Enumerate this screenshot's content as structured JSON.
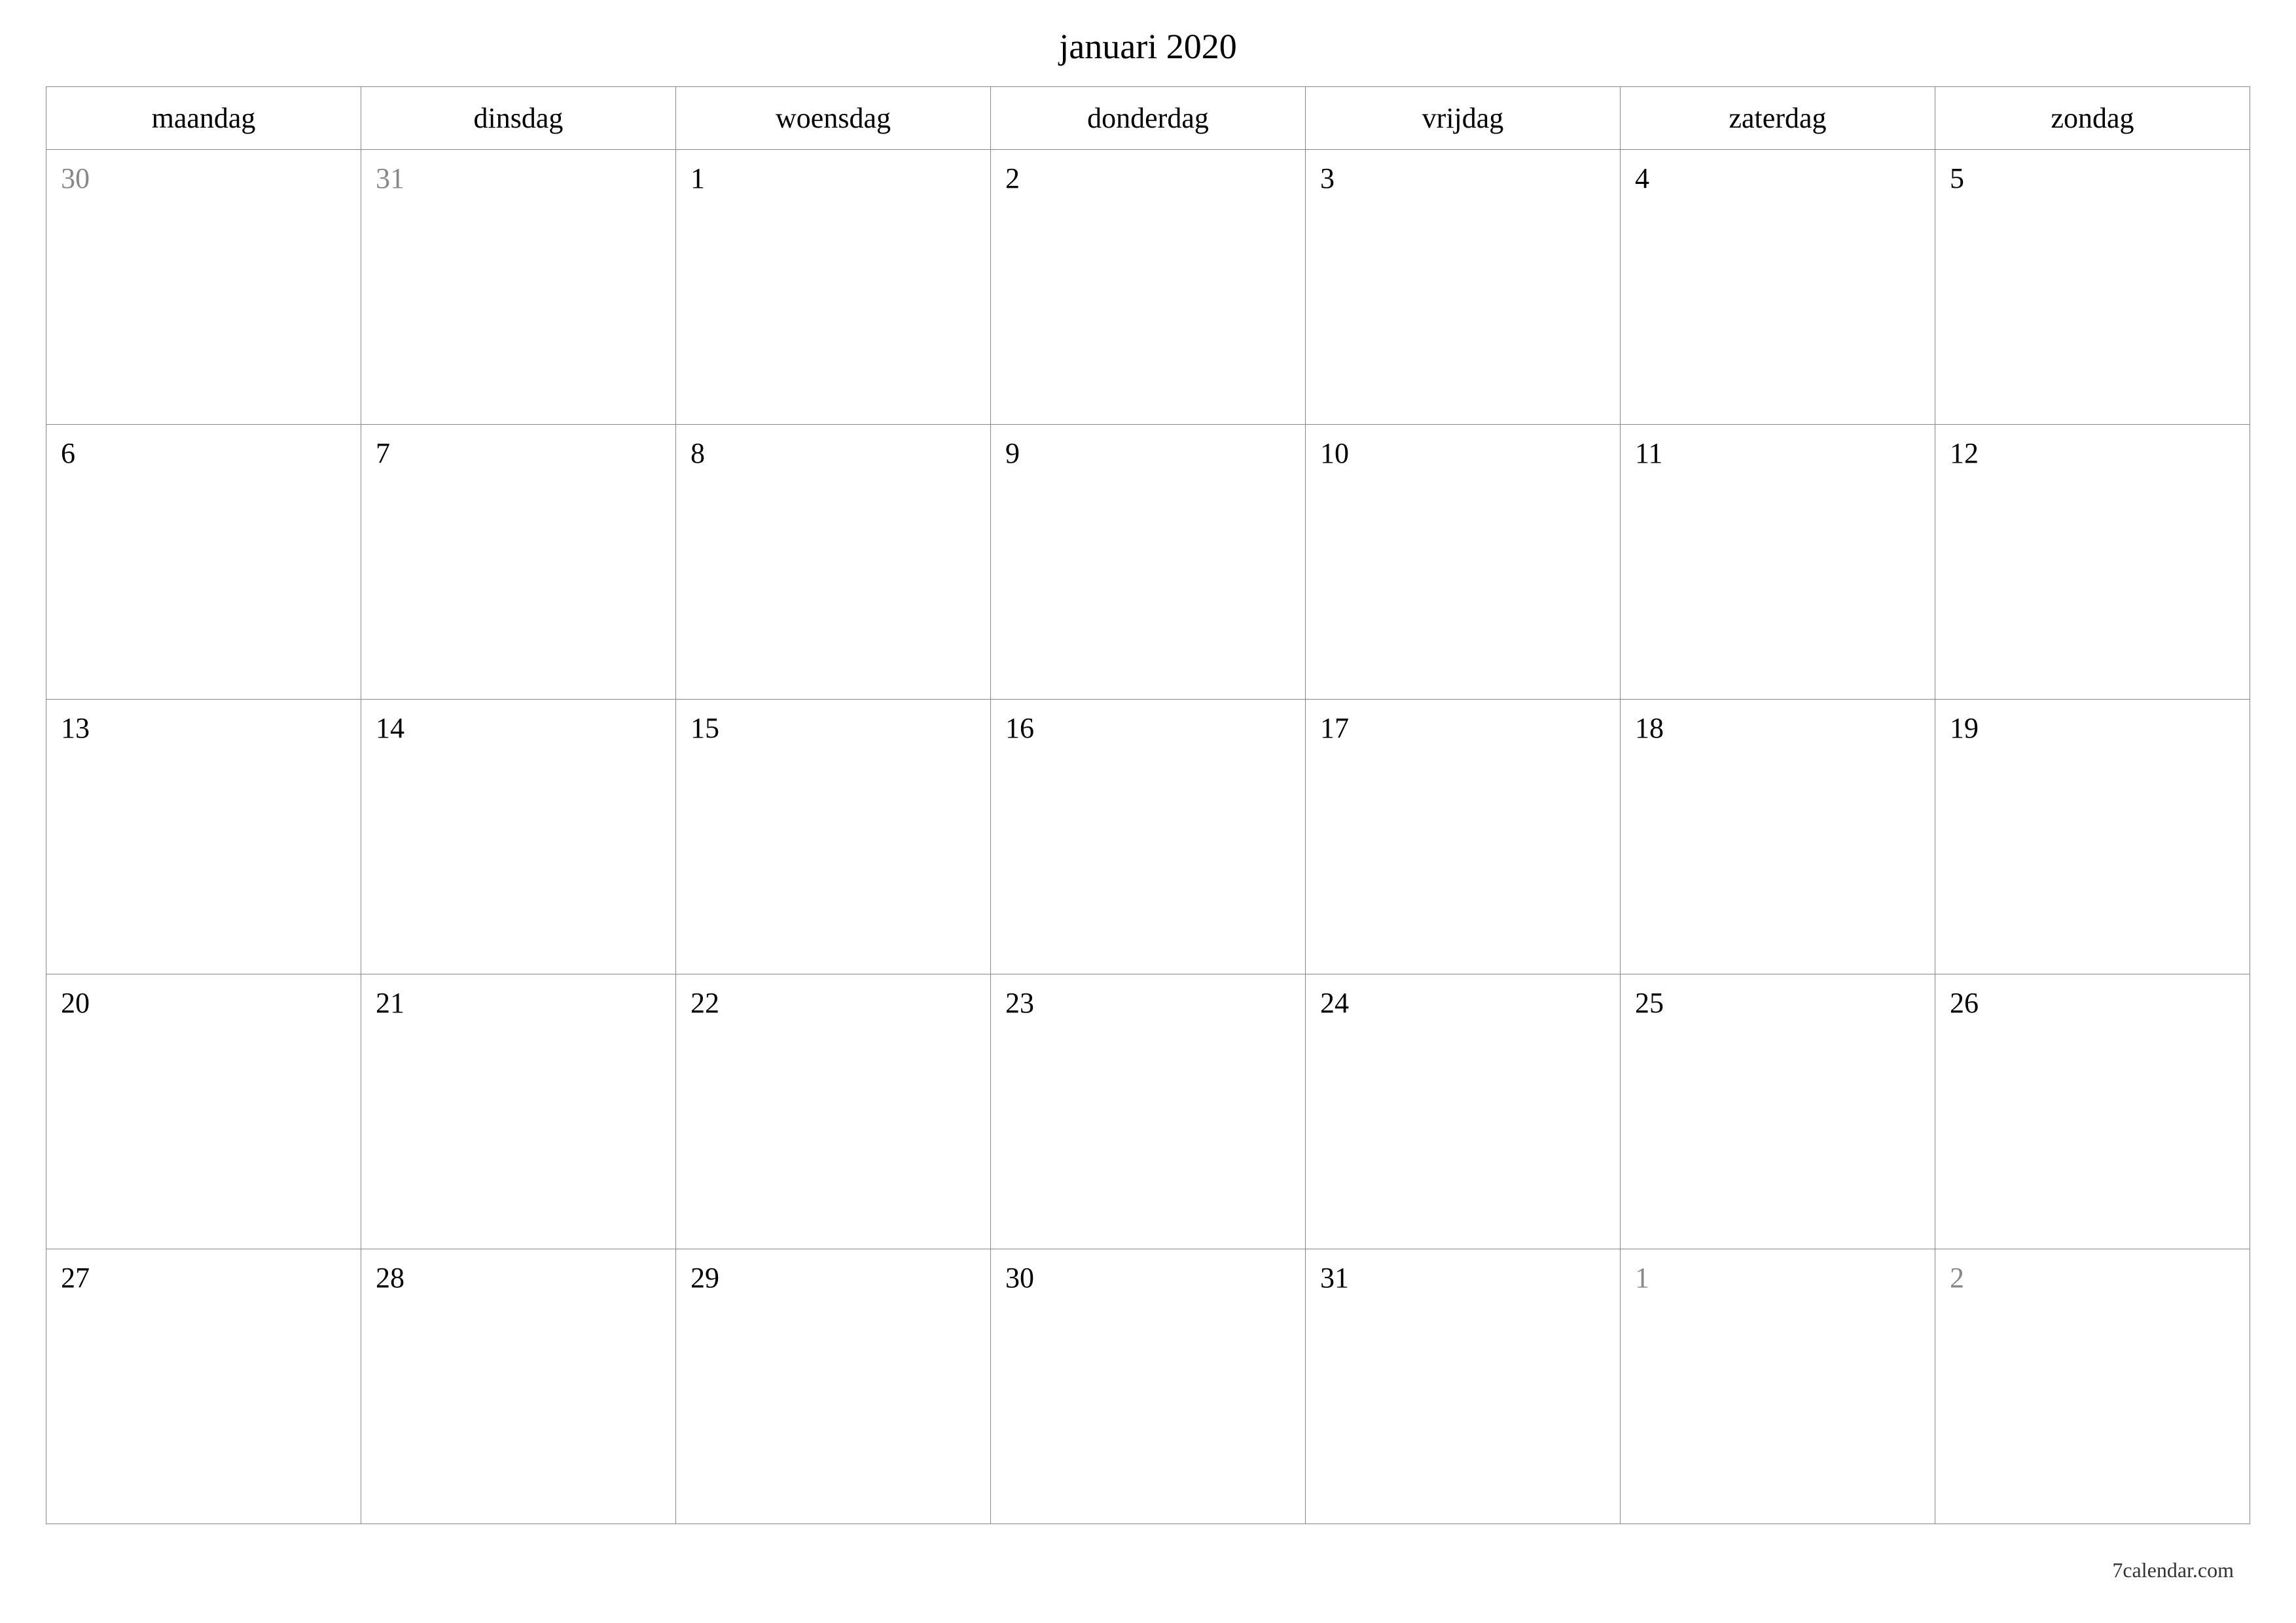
{
  "title": "januari 2020",
  "weekdays": [
    "maandag",
    "dinsdag",
    "woensdag",
    "donderdag",
    "vrijdag",
    "zaterdag",
    "zondag"
  ],
  "weeks": [
    [
      {
        "day": "30",
        "other": true
      },
      {
        "day": "31",
        "other": true
      },
      {
        "day": "1",
        "other": false
      },
      {
        "day": "2",
        "other": false
      },
      {
        "day": "3",
        "other": false
      },
      {
        "day": "4",
        "other": false
      },
      {
        "day": "5",
        "other": false
      }
    ],
    [
      {
        "day": "6",
        "other": false
      },
      {
        "day": "7",
        "other": false
      },
      {
        "day": "8",
        "other": false
      },
      {
        "day": "9",
        "other": false
      },
      {
        "day": "10",
        "other": false
      },
      {
        "day": "11",
        "other": false
      },
      {
        "day": "12",
        "other": false
      }
    ],
    [
      {
        "day": "13",
        "other": false
      },
      {
        "day": "14",
        "other": false
      },
      {
        "day": "15",
        "other": false
      },
      {
        "day": "16",
        "other": false
      },
      {
        "day": "17",
        "other": false
      },
      {
        "day": "18",
        "other": false
      },
      {
        "day": "19",
        "other": false
      }
    ],
    [
      {
        "day": "20",
        "other": false
      },
      {
        "day": "21",
        "other": false
      },
      {
        "day": "22",
        "other": false
      },
      {
        "day": "23",
        "other": false
      },
      {
        "day": "24",
        "other": false
      },
      {
        "day": "25",
        "other": false
      },
      {
        "day": "26",
        "other": false
      }
    ],
    [
      {
        "day": "27",
        "other": false
      },
      {
        "day": "28",
        "other": false
      },
      {
        "day": "29",
        "other": false
      },
      {
        "day": "30",
        "other": false
      },
      {
        "day": "31",
        "other": false
      },
      {
        "day": "1",
        "other": true
      },
      {
        "day": "2",
        "other": true
      }
    ]
  ],
  "footer": "7calendar.com"
}
